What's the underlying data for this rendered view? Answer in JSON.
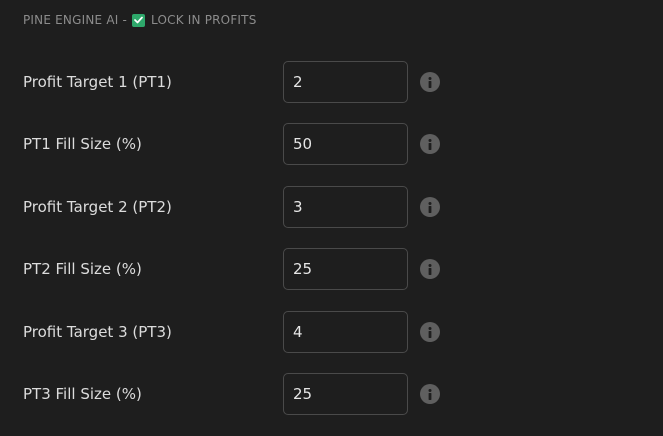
{
  "header": {
    "prefix": "PINE ENGINE AI -",
    "section_title": "LOCK IN PROFITS",
    "checked": true,
    "check_color": "#2ea86b"
  },
  "fields": [
    {
      "label": "Profit Target 1 (PT1)",
      "value": "2"
    },
    {
      "label": "PT1 Fill Size (%)",
      "value": "50"
    },
    {
      "label": "Profit Target 2 (PT2)",
      "value": "3"
    },
    {
      "label": "PT2 Fill Size (%)",
      "value": "25"
    },
    {
      "label": "Profit Target 3 (PT3)",
      "value": "4"
    },
    {
      "label": "PT3 Fill Size (%)",
      "value": "25"
    }
  ],
  "icons": {
    "info": "info-icon",
    "checkbox": "checkbox-checked-icon"
  }
}
